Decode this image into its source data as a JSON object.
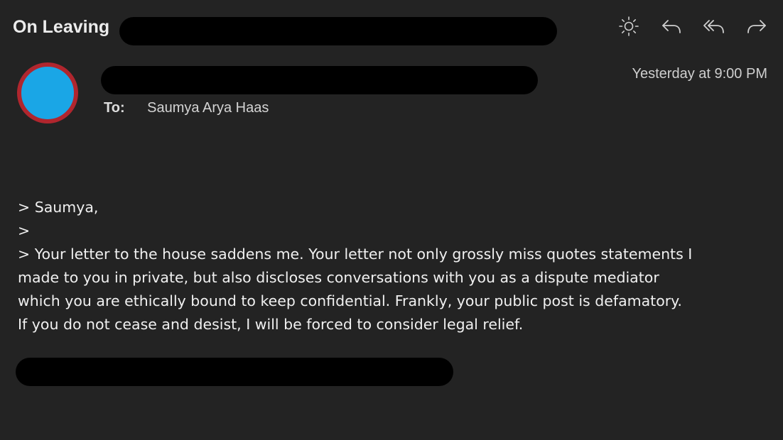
{
  "message": {
    "subject": "On Leaving",
    "to_label": "To:",
    "recipient": "Saumya Arya Haas",
    "date": "Yesterday at 9:00 PM",
    "body_lines": [
      "> Saumya,",
      ">",
      "> Your letter to the house saddens me. Your letter not only grossly miss quotes statements I",
      "made to you in private, but also discloses conversations with you as a dispute mediator",
      "which you are ethically bound to keep confidential. Frankly, your public post is defamatory.",
      "If you do not cease and desist, I will be forced to consider legal relief."
    ]
  },
  "toolbar": {
    "buttons": [
      {
        "icon": "sun-icon",
        "name": "appearance-button"
      },
      {
        "icon": "reply-icon",
        "name": "reply-button"
      },
      {
        "icon": "reply-all-icon",
        "name": "reply-all-button"
      },
      {
        "icon": "forward-icon",
        "name": "forward-button"
      }
    ]
  },
  "colors": {
    "background": "#232323",
    "avatar_fill": "#1aa6e6",
    "avatar_ring": "#b0262e",
    "redaction": "#000000"
  }
}
